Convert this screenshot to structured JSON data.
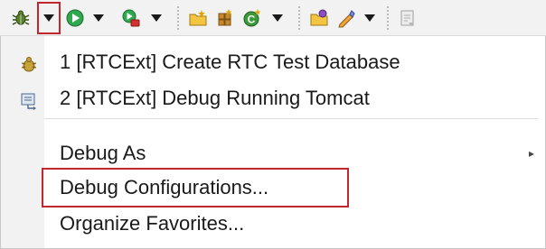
{
  "toolbar": {
    "icons": [
      "debug-icon",
      "dropdown-arrow",
      "run-icon",
      "dropdown-arrow",
      "external-tools-icon",
      "dropdown-arrow",
      "new-project-icon",
      "new-package-icon",
      "new-class-icon",
      "dropdown-arrow",
      "open-type-icon",
      "search-icon",
      "dropdown-arrow",
      "annotation-icon"
    ],
    "highlight_color": "#c1272d"
  },
  "menu": {
    "favorites": [
      {
        "label": "1 [RTCExt] Create RTC Test Database",
        "icon": "database-icon"
      },
      {
        "label": "2 [RTCExt] Debug Running Tomcat",
        "icon": "remote-debug-icon"
      }
    ],
    "items": [
      {
        "label": "Debug As",
        "has_submenu": true
      },
      {
        "label": "Debug Configurations...",
        "highlighted": true
      },
      {
        "label": "Organize Favorites..."
      }
    ],
    "submenu_glyph": "▸"
  }
}
